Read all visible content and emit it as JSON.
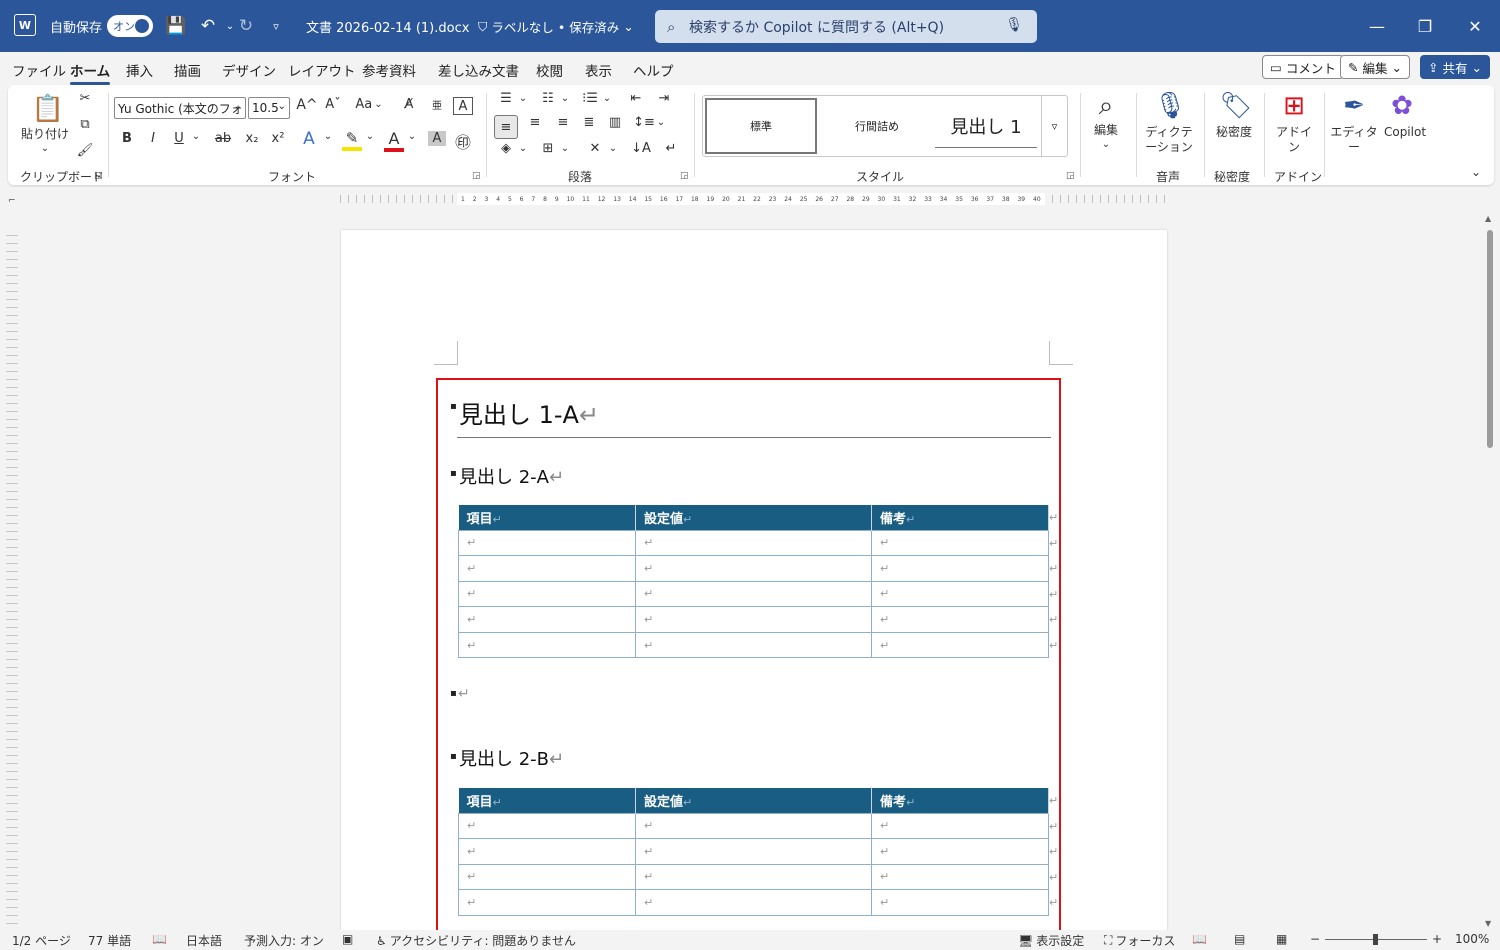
{
  "titlebar": {
    "app_icon": "W",
    "autosave_label": "自動保存",
    "autosave_state": "オン",
    "doc_title": "文書  2026-02-14 (1).docx",
    "label_status": "ラベルなし • 保存済み",
    "search_placeholder": "検索するか Copilot に質問する (Alt+Q)",
    "minimize": "—",
    "restore": "❐",
    "close": "✕"
  },
  "menu": {
    "tabs": [
      "ファイル",
      "ホーム",
      "挿入",
      "描画",
      "デザイン",
      "レイアウト",
      "参考資料",
      "差し込み文書",
      "校閲",
      "表示",
      "ヘルプ"
    ],
    "active_tab": "ホーム",
    "comment": "コメント",
    "edit": "編集",
    "share": "共有"
  },
  "ribbon": {
    "clipboard": {
      "paste": "貼り付け",
      "group": "クリップボード"
    },
    "font": {
      "name": "Yu Gothic (本文のフォ",
      "size": "10.5",
      "group": "フォント",
      "bold": "B",
      "italic": "I",
      "underline": "U",
      "strike": "ab",
      "sub": "x₂",
      "sup": "x²",
      "grow": "A^",
      "shrink": "Aˇ",
      "case": "Aa"
    },
    "paragraph": {
      "group": "段落"
    },
    "styles": {
      "normal": "標準",
      "no_spacing": "行間詰め",
      "heading1": "見出し 1",
      "group": "スタイル"
    },
    "editing": {
      "label": "編集"
    },
    "voice": {
      "label": "ディクテーション",
      "group": "音声"
    },
    "sensitivity": {
      "label": "秘密度",
      "group": "秘密度"
    },
    "addins": {
      "label": "アドイン",
      "group": "アドイン"
    },
    "editor": {
      "label": "エディター"
    },
    "copilot": {
      "label": "Copilot"
    }
  },
  "document": {
    "heading1": "見出し 1-A",
    "heading2a": "見出し 2-A",
    "heading2b": "見出し 2-B",
    "return_mark": "↵",
    "table_headers": [
      "項目",
      "設定値",
      "備考"
    ],
    "table1_rows": 5,
    "table2_rows": 4
  },
  "statusbar": {
    "page": "1/2 ページ",
    "words": "77 単語",
    "language": "日本語",
    "predict": "予測入力: オン",
    "accessibility": "アクセシビリティ: 問題ありません",
    "display_settings": "表示設定",
    "focus": "フォーカス",
    "zoom": "100%"
  },
  "colors": {
    "titlebar": "#2b579a",
    "table_header": "#1a5d82",
    "highlight_border": "#e0101a"
  }
}
